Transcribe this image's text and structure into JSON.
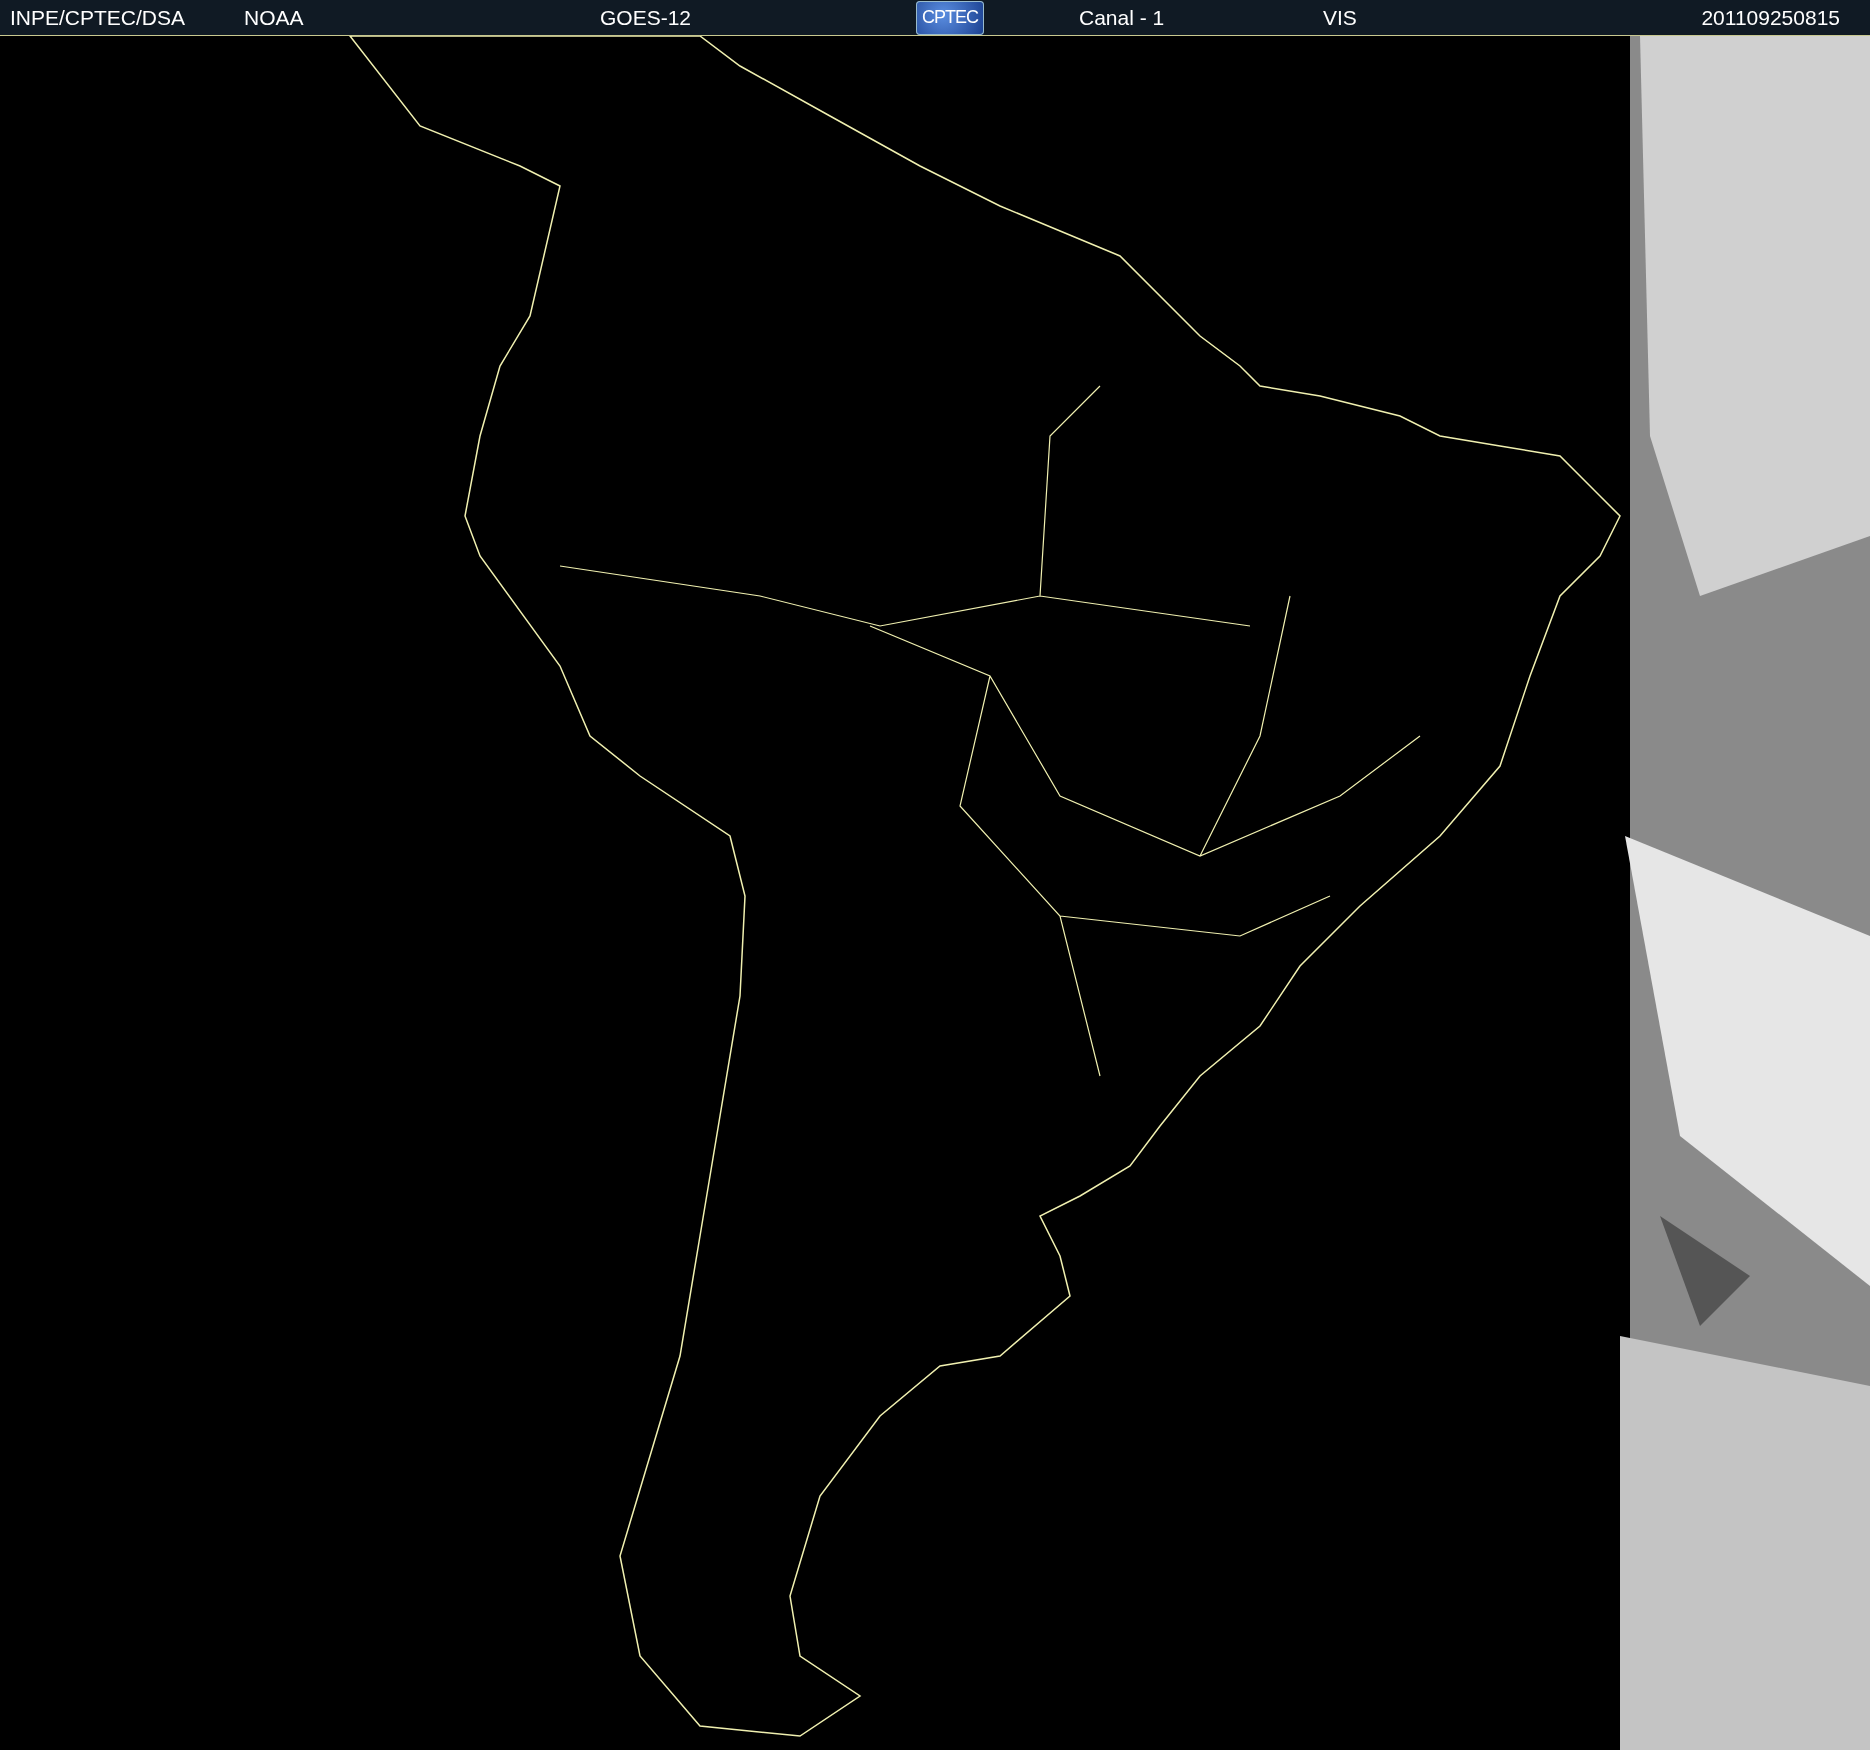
{
  "header": {
    "items": [
      {
        "kind": "text",
        "text": "INPE/CPTEC/DSA"
      },
      {
        "kind": "text",
        "text": "NOAA"
      },
      {
        "kind": "text",
        "text": "GOES-12"
      },
      {
        "kind": "logo",
        "text": "CPTEC"
      },
      {
        "kind": "text",
        "text": "Canal - 1"
      },
      {
        "kind": "text",
        "text": "VIS"
      },
      {
        "kind": "text",
        "text": "201109250815"
      }
    ]
  }
}
